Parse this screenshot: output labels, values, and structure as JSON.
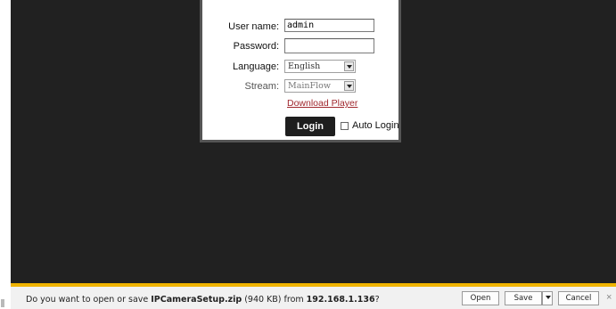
{
  "login": {
    "username_label": "User name:",
    "username_value": "admin",
    "password_label": "Password:",
    "password_value": "",
    "language_label": "Language:",
    "language_value": "English",
    "stream_label": "Stream:",
    "stream_value": "MainFlow",
    "download_link": "Download Player",
    "login_button": "Login",
    "auto_login_label": "Auto Login",
    "auto_login_checked": false
  },
  "download_bar": {
    "prefix": "Do you want to open or save ",
    "filename": "IPCameraSetup.zip",
    "size": " (940 KB) from ",
    "host": "192.168.1.136",
    "suffix": "?",
    "open_button": "Open",
    "save_button": "Save",
    "cancel_button": "Cancel",
    "close_glyph": "×"
  },
  "icons": {
    "close": "close-icon",
    "dropdown": "chevron-down-icon"
  },
  "colors": {
    "stage_background": "#212121",
    "link": "#a0282e",
    "notification_accent": "#f0b400"
  }
}
